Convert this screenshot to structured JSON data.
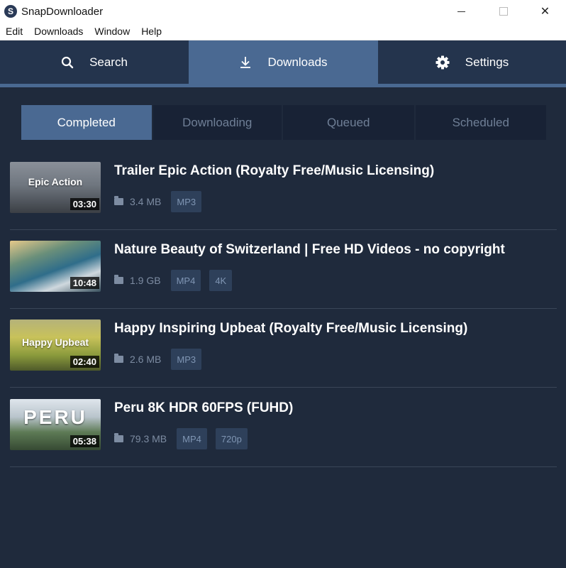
{
  "window": {
    "title": "SnapDownloader",
    "icon_letter": "S",
    "close": "✕"
  },
  "menu": [
    "Edit",
    "Downloads",
    "Window",
    "Help"
  ],
  "main_tabs": [
    {
      "label": "Search",
      "icon": "search-icon"
    },
    {
      "label": "Downloads",
      "icon": "download-icon",
      "active": true
    },
    {
      "label": "Settings",
      "icon": "gear-icon"
    }
  ],
  "sub_tabs": [
    "Completed",
    "Downloading",
    "Queued",
    "Scheduled"
  ],
  "items": [
    {
      "title": "Trailer Epic Action (Royalty Free/Music Licensing)",
      "duration": "03:30",
      "size": "3.4 MB",
      "badges": [
        "MP3"
      ],
      "thumb_label": "Epic Action"
    },
    {
      "title": "Nature Beauty of Switzerland | Free HD Videos - no copyright",
      "duration": "10:48",
      "size": "1.9 GB",
      "badges": [
        "MP4",
        "4K"
      ],
      "thumb_label": ""
    },
    {
      "title": "Happy Inspiring Upbeat (Royalty Free/Music Licensing)",
      "duration": "02:40",
      "size": "2.6 MB",
      "badges": [
        "MP3"
      ],
      "thumb_label": "Happy Upbeat"
    },
    {
      "title": "Peru 8K HDR 60FPS (FUHD)",
      "duration": "05:38",
      "size": "79.3 MB",
      "badges": [
        "MP4",
        "720p"
      ],
      "thumb_label": "PERU"
    }
  ],
  "colors": {
    "accent": "#4a6992",
    "background": "#1f2a3c",
    "tab_bar": "#24344d"
  }
}
